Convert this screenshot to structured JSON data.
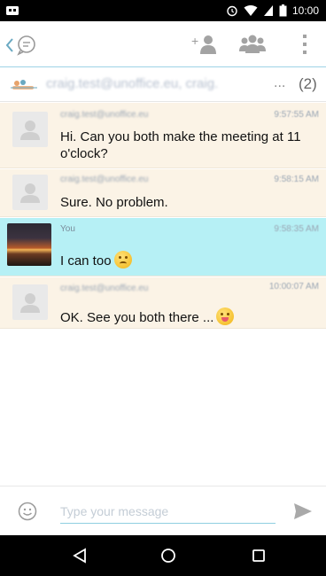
{
  "status_bar": {
    "time": "10:00",
    "icons": [
      "notification-icon",
      "alarm-icon",
      "wifi-icon",
      "signal-icon",
      "battery-icon"
    ]
  },
  "toolbar": {
    "icons": [
      "back-icon",
      "chat-icon",
      "add-participant-icon",
      "participants-icon",
      "overflow-menu-icon"
    ]
  },
  "participants": {
    "emails": "craig.test@unoffice.eu, craig.",
    "ellipsis": "...",
    "count": "(2)"
  },
  "messages": [
    {
      "sender": "craig.test@unoffice.eu",
      "time": "9:57:55 AM",
      "text": "Hi. Can you both make the meeting at 11 o'clock?",
      "emoji": ""
    },
    {
      "sender": "craig.test@unoffice.eu",
      "time": "9:58:15 AM",
      "text": "Sure. No problem.",
      "emoji": ""
    },
    {
      "sender": "You",
      "time": "9:58:35 AM",
      "text": "I can too",
      "emoji": "worried-face-emoji"
    },
    {
      "sender": "craig.test@unoffice.eu",
      "time": "10:00:07 AM",
      "text": "OK. See you both there ...",
      "emoji": "tongue-face-emoji"
    }
  ],
  "composer": {
    "placeholder": "Type your message",
    "value": ""
  },
  "colors": {
    "accent": "#1aa0c8",
    "other_message_bg": "#fbf3e6",
    "own_message_bg": "#b6f0f5"
  }
}
